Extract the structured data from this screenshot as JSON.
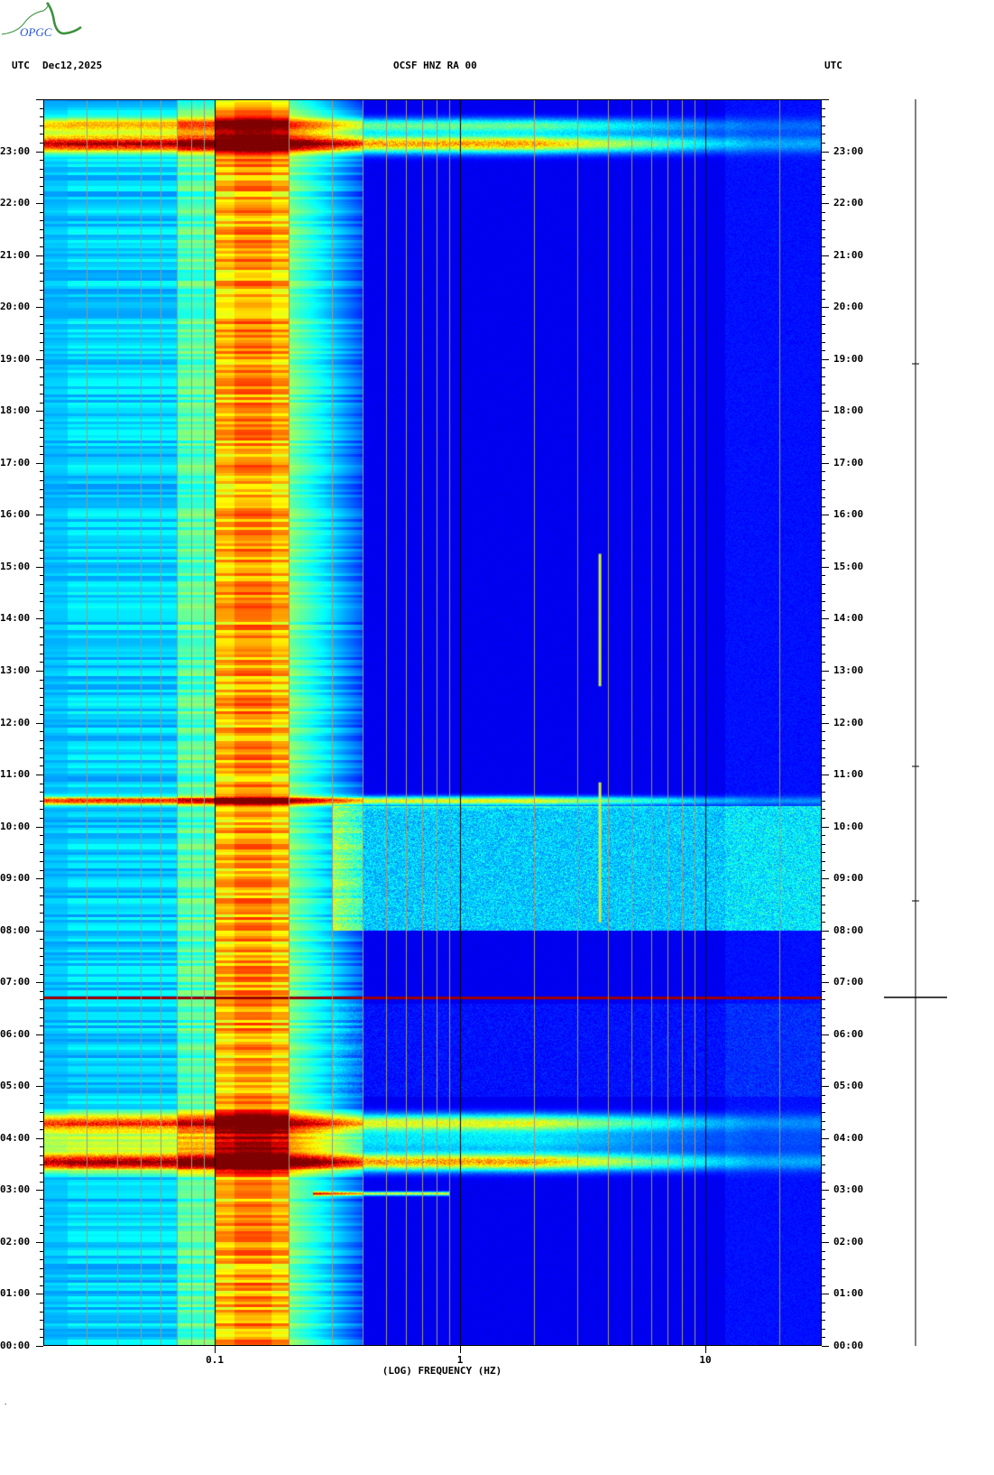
{
  "logo": {
    "text": "OPGC"
  },
  "header": {
    "tz_left": "UTC",
    "date": "Dec12,2025",
    "station": "OCSF HNZ RA 00",
    "tz_right": "UTC"
  },
  "colors": {
    "background_low": "#0000c8",
    "grid_minor": "#a09a7a",
    "grid_major": "#000000"
  },
  "chart_data": {
    "type": "heatmap",
    "title": "OCSF HNZ RA 00",
    "xlabel": "(LOG) FREQUENCY (HZ)",
    "ylabel": "UTC",
    "x_scale": "log",
    "xlim": [
      0.02,
      29.8
    ],
    "ylim_hours": [
      0,
      24
    ],
    "x_ticks": [
      {
        "value": 0.1,
        "label": "0.1"
      },
      {
        "value": 1,
        "label": "1"
      },
      {
        "value": 10,
        "label": "10"
      }
    ],
    "y_ticks": [
      "00:00",
      "01:00",
      "02:00",
      "03:00",
      "04:00",
      "05:00",
      "06:00",
      "07:00",
      "08:00",
      "09:00",
      "10:00",
      "11:00",
      "12:00",
      "13:00",
      "14:00",
      "15:00",
      "16:00",
      "17:00",
      "18:00",
      "19:00",
      "20:00",
      "21:00",
      "22:00",
      "23:00"
    ],
    "colormap": "jet",
    "microseism_band_hz": [
      0.1,
      0.2
    ],
    "events": [
      {
        "name": "broadband-noise-23h",
        "start_h": 22.9,
        "end_h": 23.7,
        "peak_h": 23.15,
        "level": 0.95
      },
      {
        "name": "broadband-noise-04h",
        "start_h": 3.3,
        "end_h": 4.55,
        "peak_h": 3.6,
        "level": 0.95
      },
      {
        "name": "broadband-noise-10h30",
        "start_h": 10.4,
        "end_h": 10.6,
        "peak_h": 10.5,
        "level": 0.85
      },
      {
        "name": "elevated-noise",
        "start_h": 8.0,
        "end_h": 10.4,
        "peak_h": 9.3,
        "level": 0.35
      },
      {
        "name": "spike-06h42",
        "start_h": 6.68,
        "end_h": 6.74,
        "peak_h": 6.71,
        "level": 1.0
      },
      {
        "name": "line-02h56",
        "start_h": 2.92,
        "end_h": 2.97,
        "peak_h": 2.94,
        "level": 0.8
      }
    ],
    "tonal_lines": [
      {
        "freq_hz": 3.7,
        "start_h": 8.15,
        "end_h": 10.85
      },
      {
        "freq_hz": 3.7,
        "start_h": 12.7,
        "end_h": 15.25
      }
    ]
  },
  "trace": {
    "event_hour": 6.71
  }
}
